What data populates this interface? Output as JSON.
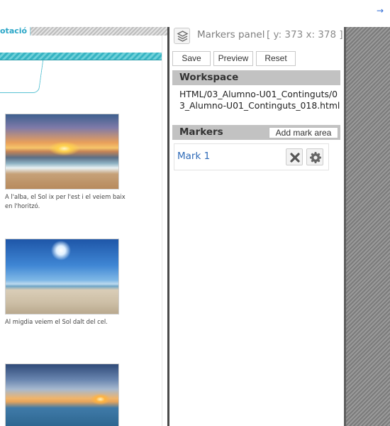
{
  "top_bar": {
    "arrow_icon": "arrow-right-icon"
  },
  "content": {
    "tab_label": "otació",
    "images": [
      {
        "icon": "sunrise-beach-photo"
      },
      {
        "icon": "midday-beach-photo"
      },
      {
        "icon": "sunset-beach-photo"
      }
    ],
    "captions": [
      "A l'alba, el Sol ix per l'est i el veiem baix en l'horitzó.",
      "Al migdia veiem el Sol dalt del cel."
    ]
  },
  "panel": {
    "title": "Markers panel",
    "coords": "[ y: 373 x: 378 ]",
    "layers_icon": "layers-icon",
    "toolbar": {
      "save": "Save",
      "preview": "Preview",
      "reset": "Reset"
    },
    "workspace": {
      "heading": "Workspace",
      "path": "HTML/03_Alumno-U01_Continguts/03_Alumno-U01_Continguts_018.html"
    },
    "markers": {
      "heading": "Markers",
      "add_label": "Add mark area",
      "items": [
        {
          "label": "Mark 1",
          "delete_icon": "close-icon",
          "settings_icon": "gear-icon"
        }
      ]
    }
  },
  "colors": {
    "accent_teal": "#37b4c3",
    "link_blue": "#2f6bb8",
    "section_gray": "#c2c2c2"
  }
}
